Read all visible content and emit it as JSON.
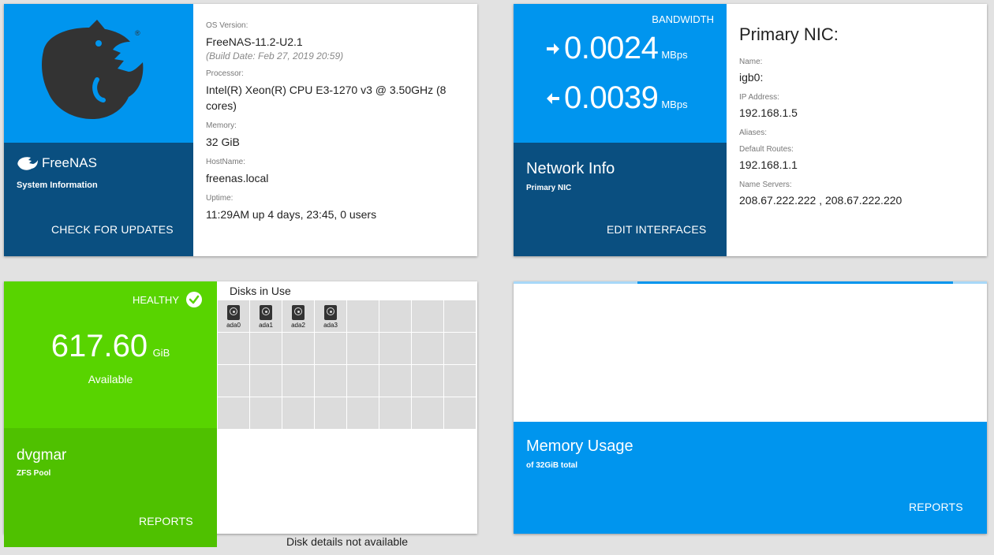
{
  "system": {
    "brand": "FreeNAS",
    "subtitle": "System Information",
    "action": "CHECK FOR UPDATES",
    "fields": [
      {
        "label": "OS Version:",
        "value": "FreeNAS-11.2-U2.1",
        "sub": "(Build Date: Feb 27, 2019 20:59)"
      },
      {
        "label": "Processor:",
        "value": "Intel(R) Xeon(R) CPU E3-1270 v3 @ 3.50GHz (8 cores)"
      },
      {
        "label": "Memory:",
        "value": "32 GiB"
      },
      {
        "label": "HostName:",
        "value": "freenas.local"
      },
      {
        "label": "Uptime:",
        "value": "11:29AM up 4 days, 23:45, 0 users"
      }
    ],
    "colors": {
      "logo_bg": "#0095ee",
      "info_bg": "#0a4f80"
    }
  },
  "network": {
    "bandwidth_label": "BANDWIDTH",
    "out_value": "0.0024",
    "out_unit": "MBps",
    "in_value": "0.0039",
    "in_unit": "MBps",
    "title": "Network Info",
    "subtitle": "Primary NIC",
    "action": "EDIT INTERFACES",
    "nic_title": "Primary NIC:",
    "fields": [
      {
        "label": "Name:",
        "value": "igb0:"
      },
      {
        "label": "IP Address:",
        "value": "192.168.1.5"
      },
      {
        "label": "Aliases:",
        "value": ""
      },
      {
        "label": "Default Routes:",
        "value": "192.168.1.1"
      },
      {
        "label": "Name Servers:",
        "value": "208.67.222.222 , 208.67.222.220"
      }
    ]
  },
  "pool": {
    "status": "HEALTHY",
    "available_value": "617.60",
    "available_unit": "GiB",
    "available_label": "Available",
    "name": "dvgmar",
    "subtitle": "ZFS Pool",
    "action": "REPORTS",
    "disks_title": "Disks in Use",
    "disks": [
      "ada0",
      "ada1",
      "ada2",
      "ada3"
    ],
    "disk_note": "Disk details not available",
    "colors": {
      "health_bg": "#58d400",
      "name_bg": "#4fc100"
    }
  },
  "memory": {
    "title": "Memory Usage",
    "subtitle": "of 32GiB total",
    "action": "REPORTS",
    "colors": {
      "bg": "#0095ee",
      "progress_track": "#a8d8f8"
    }
  }
}
